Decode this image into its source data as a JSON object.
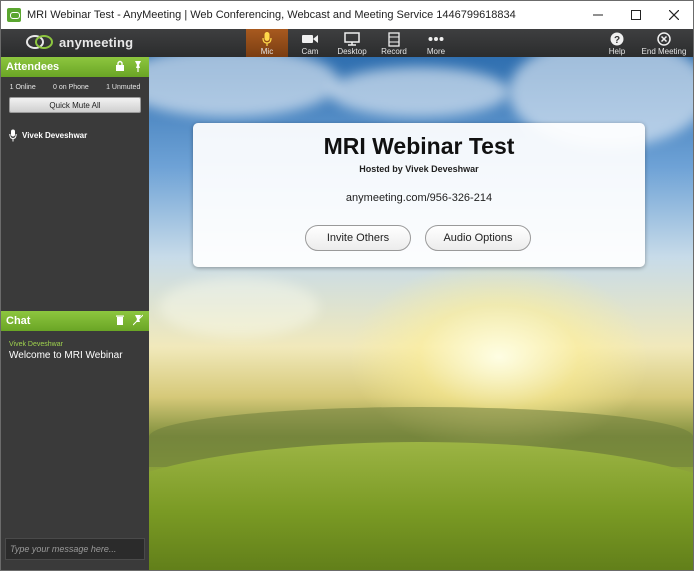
{
  "window": {
    "title": "MRI Webinar Test - AnyMeeting | Web Conferencing, Webcast and Meeting Service 1446799618834",
    "controls": {
      "minimize": "—",
      "maximize": "☐",
      "close": "✕"
    }
  },
  "toolbar": {
    "logo_text": "anymeeting",
    "tools": [
      {
        "label": "Mic",
        "icon": "microphone-icon",
        "active": true
      },
      {
        "label": "Cam",
        "icon": "camera-icon"
      },
      {
        "label": "Desktop",
        "icon": "monitor-icon"
      },
      {
        "label": "Record",
        "icon": "film-icon"
      },
      {
        "label": "More",
        "icon": "ellipsis-icon"
      },
      {
        "label": "Help",
        "icon": "help-icon"
      },
      {
        "label": "End Meeting",
        "icon": "close-circle-icon"
      }
    ]
  },
  "attendees": {
    "title": "Attendees",
    "counts": {
      "online": "1 Online",
      "phone": "0 on Phone",
      "unmuted": "1 Unmuted"
    },
    "quick_mute": "Quick Mute All",
    "list": [
      {
        "name": "Vivek Deveshwar",
        "icon": "microphone-icon"
      }
    ]
  },
  "chat": {
    "title": "Chat",
    "messages": [
      {
        "sender": "Vivek Deveshwar",
        "text": "Welcome to MRI Webinar"
      }
    ],
    "input_placeholder": "Type your message here..."
  },
  "meeting": {
    "title": "MRI Webinar Test",
    "host": "Hosted by Vivek Deveshwar",
    "url": "anymeeting.com/956-326-214",
    "invite_button": "Invite Others",
    "audio_button": "Audio Options"
  },
  "colors": {
    "accent_green": "#8dc63f",
    "active_tool": "#a85a1f",
    "toolbar_bg": "#333435",
    "sidebar_bg": "#3a3a3a"
  }
}
